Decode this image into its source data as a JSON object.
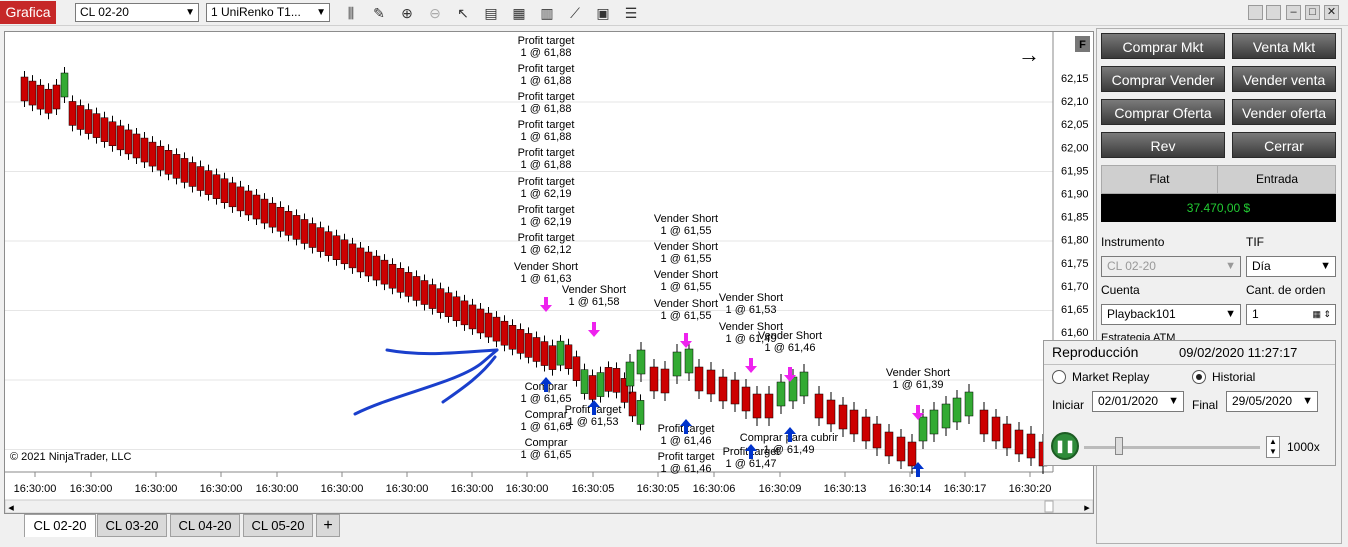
{
  "toolbar": {
    "logo": "Grafica",
    "instrument": "CL 02-20",
    "bar_type": "1 UniRenko T1..."
  },
  "chart": {
    "copyright": "© 2021 NinjaTrader, LLC",
    "f_badge": "F",
    "y_ticks": [
      "62,15",
      "62,10",
      "62,05",
      "62,00",
      "61,95",
      "61,90",
      "61,85",
      "61,80",
      "61,75",
      "61,70",
      "61,65",
      "61,60"
    ],
    "x_ticks": [
      "16:30:00",
      "16:30:00",
      "16:30:00",
      "16:30:00",
      "16:30:00",
      "16:30:00",
      "16:30:00",
      "16:30:00",
      "16:30:00",
      "16:30:05",
      "16:30:05",
      "16:30:06",
      "16:30:09",
      "16:30:13",
      "16:30:14",
      "16:30:17",
      "16:30:20"
    ],
    "annotations": [
      {
        "text": "Profit target",
        "sub": "1 @ 61,88"
      },
      {
        "text": "Profit target",
        "sub": "1 @ 61,88"
      },
      {
        "text": "Profit target",
        "sub": "1 @ 61,88"
      },
      {
        "text": "Profit target",
        "sub": "1 @ 61,88"
      },
      {
        "text": "Profit target",
        "sub": "1 @ 61,88"
      },
      {
        "text": "Profit target",
        "sub": "1 @ 62,19"
      },
      {
        "text": "Profit target",
        "sub": "1 @ 62,19"
      },
      {
        "text": "Profit target",
        "sub": "1 @ 62,12"
      },
      {
        "text": "Vender Short",
        "sub": "1 @ 61,63"
      },
      {
        "text": "Vender Short",
        "sub": "1 @ 61,58"
      },
      {
        "text": "Vender Short",
        "sub": "1 @ 61,55"
      },
      {
        "text": "Vender Short",
        "sub": "1 @ 61,55"
      },
      {
        "text": "Vender Short",
        "sub": "1 @ 61,55"
      },
      {
        "text": "Vender Short",
        "sub": "1 @ 61,55"
      },
      {
        "text": "Vender Short",
        "sub": "1 @ 61,53"
      },
      {
        "text": "Vender Short",
        "sub": "1 @ 61,49"
      },
      {
        "text": "Vender Short",
        "sub": "1 @ 61,46"
      },
      {
        "text": "Vender Short",
        "sub": "1 @ 61,39"
      },
      {
        "text": "Comprar",
        "sub": "1 @ 61,65"
      },
      {
        "text": "Comprar",
        "sub": "1 @ 61,65"
      },
      {
        "text": "Comprar",
        "sub": "1 @ 61,65"
      },
      {
        "text": "Profit target",
        "sub": "1 @ 61,53"
      },
      {
        "text": "Profit target",
        "sub": "1 @ 61,46"
      },
      {
        "text": "Profit target",
        "sub": "1 @ 61,46"
      },
      {
        "text": "Profit target",
        "sub": "1 @ 61,47"
      },
      {
        "text": "Comprar para cubrir",
        "sub": "1 @ 61,49"
      }
    ]
  },
  "order_panel": {
    "buttons": [
      "Comprar Mkt",
      "Venta Mkt",
      "Comprar Vender",
      "Vender venta",
      "Comprar Oferta",
      "Vender oferta",
      "Rev",
      "Cerrar"
    ],
    "position_header": [
      "Flat",
      "Entrada"
    ],
    "pnl": "37.470,00 $",
    "instrument_label": "Instrumento",
    "instrument_value": "CL 02-20",
    "tif_label": "TIF",
    "tif_value": "Día",
    "account_label": "Cuenta",
    "account_value": "Playback101",
    "qty_label": "Cant. de orden",
    "qty_value": "1",
    "atm_label": "Estrategia ATM"
  },
  "replay": {
    "title": "Reproducción",
    "datetime": "09/02/2020 11:27:17",
    "market_replay": "Market Replay",
    "historial": "Historial",
    "start_label": "Iniciar",
    "start_value": "02/01/2020",
    "end_label": "Final",
    "end_value": "29/05/2020",
    "speed": "1000x",
    "speed_level": 0.2
  },
  "tabs": [
    "CL 02-20",
    "CL 03-20",
    "CL 04-20",
    "CL 05-20",
    "+"
  ],
  "colors": {
    "bear": "#cc0000",
    "bull": "#33aa33",
    "buy": "#0033cc",
    "sell": "#ee22ee",
    "logo": "#c62828",
    "ink": "#1a3fcc"
  }
}
